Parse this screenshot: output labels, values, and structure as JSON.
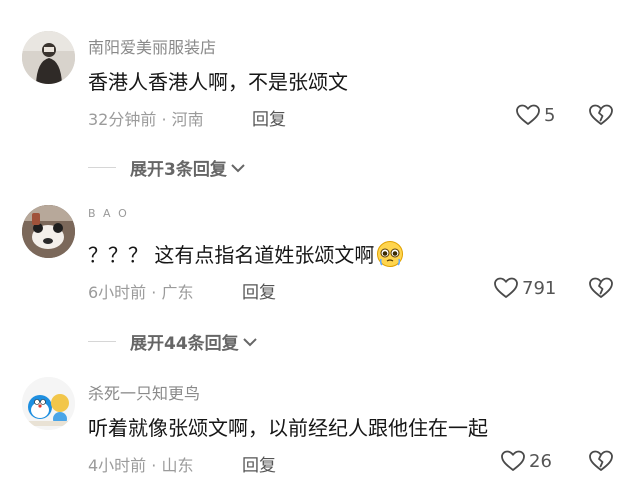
{
  "comments": [
    {
      "username": "南阳爱美丽服装店",
      "text": "香港人香港人啊，不是张颂文",
      "time_location": "32分钟前 · 河南",
      "reply_label": "回复",
      "likes": "5",
      "avatar_icon": "user-photo-avatar"
    },
    {
      "username": "B A O",
      "text": "？？？ 这有点指名道姓张颂文啊",
      "emoji": "pleading-face",
      "time_location": "6小时前 · 广东",
      "reply_label": "回复",
      "likes": "791",
      "avatar_icon": "bear-plush-avatar"
    },
    {
      "username": "杀死一只知更鸟",
      "text": "听着就像张颂文啊，以前经纪人跟他住在一起",
      "time_location": "4小时前 · 山东",
      "reply_label": "回复",
      "likes": "26",
      "avatar_icon": "doraemon-avatar"
    }
  ],
  "expand_replies": [
    {
      "label": "展开3条回复"
    },
    {
      "label": "展开44条回复"
    }
  ],
  "icons": {
    "like": "heart-outline-icon",
    "dislike": "broken-heart-icon",
    "expand": "chevron-down-icon"
  },
  "colors": {
    "text_primary": "#161616",
    "text_secondary": "#9b9b9b",
    "divider": "#d6d6d6"
  }
}
